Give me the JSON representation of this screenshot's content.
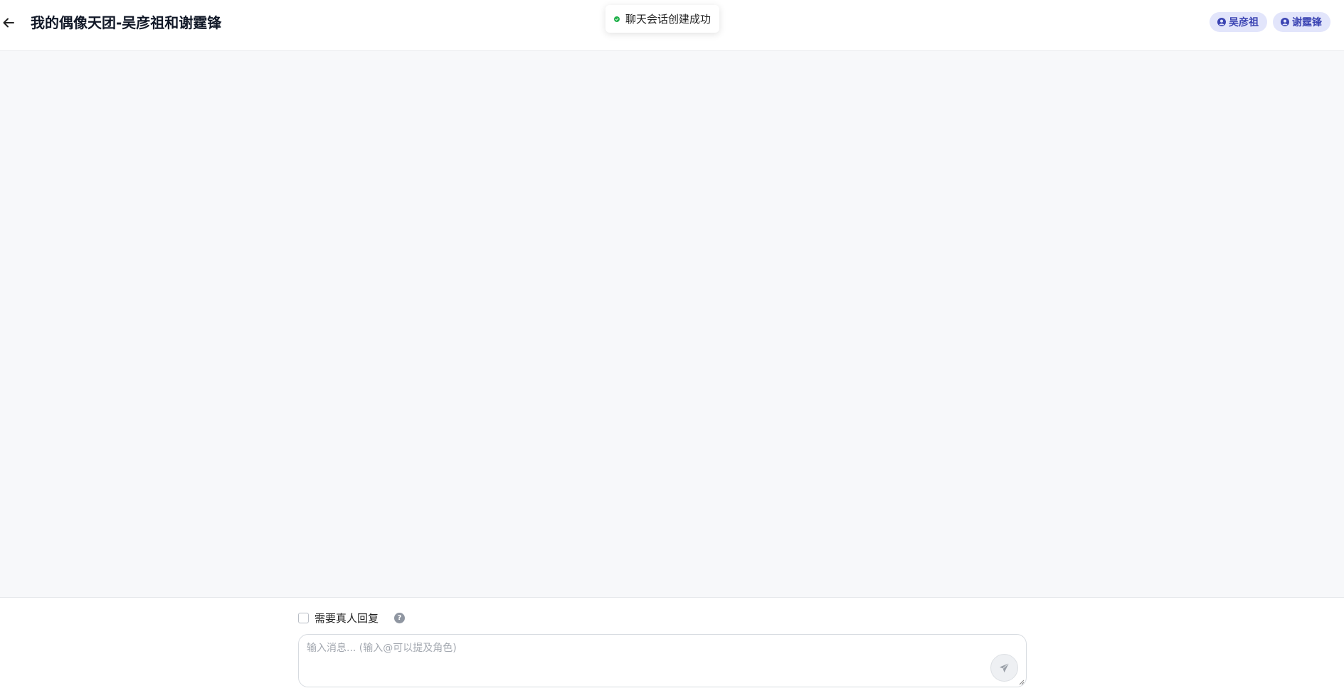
{
  "header": {
    "back_icon": "arrow-left-icon",
    "title": "我的偶像天团-吴彦祖和谢霆锋",
    "members": [
      {
        "name": "吴彦祖",
        "icon": "user-circle-icon"
      },
      {
        "name": "谢霆锋",
        "icon": "user-circle-icon"
      }
    ]
  },
  "toast": {
    "icon": "check-circle-icon",
    "message": "聊天会话创建成功"
  },
  "composer": {
    "human_reply_label": "需要真人回复",
    "human_reply_checked": false,
    "help_icon": "question-circle-icon",
    "help_glyph": "?",
    "input_placeholder": "输入消息... (输入@可以提及角色)",
    "input_value": "",
    "send_icon": "paper-plane-icon"
  },
  "colors": {
    "accent_chip_bg": "#e2e5fb",
    "accent_chip_text": "#3b44b3",
    "success": "#22b14c",
    "chat_bg": "#f7f8fa"
  }
}
